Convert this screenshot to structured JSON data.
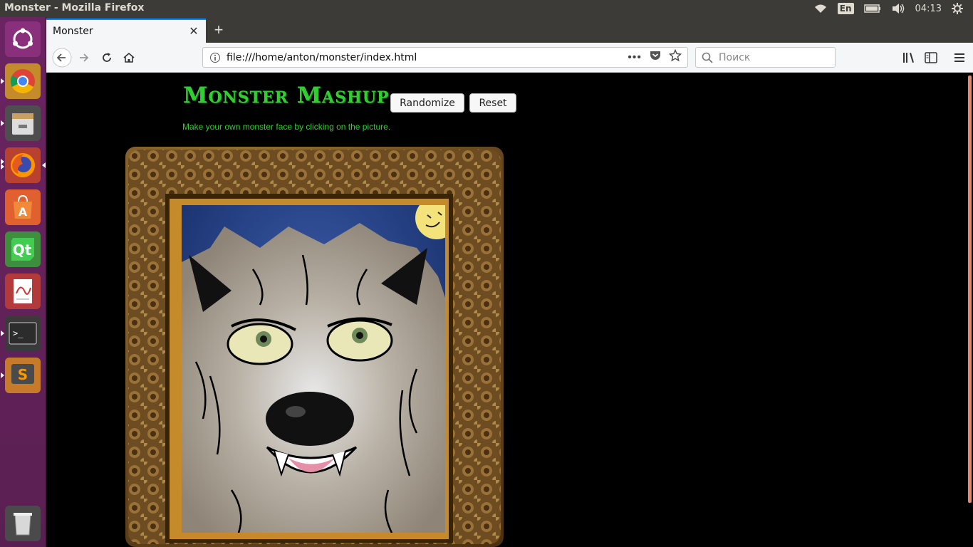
{
  "os": {
    "window_title": "Monster - Mozilla Firefox",
    "keyboard_layout": "En",
    "clock": "04:13"
  },
  "browser": {
    "tab": {
      "title": "Monster"
    },
    "url": "file:///home/anton/monster/index.html",
    "search_placeholder": "Поиск"
  },
  "page": {
    "heading": "Monster Mashup",
    "randomize_label": "Randomize",
    "reset_label": "Reset",
    "subtitle": "Make your own monster face by clicking on the picture."
  },
  "launcher": {
    "items": [
      "ubuntu-dash",
      "chrome",
      "files",
      "firefox",
      "software-center",
      "qt-creator",
      "document-viewer",
      "terminal",
      "sublime-text",
      "trash"
    ]
  },
  "colors": {
    "accent_green": "#33cc33",
    "launcher_purple": "#5e2154",
    "panel_dark": "#3c3b37"
  }
}
